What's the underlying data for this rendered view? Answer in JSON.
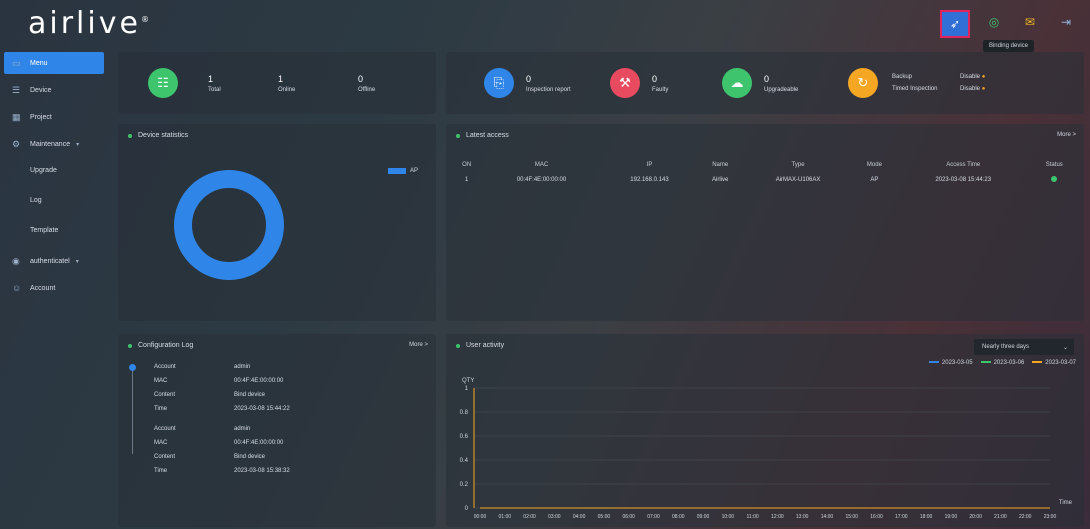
{
  "app": {
    "logo": "airlive",
    "logo_mark": "®"
  },
  "topbar": {
    "icons": [
      "rocket-icon",
      "globe-icon",
      "mail-icon",
      "logout-icon"
    ],
    "tooltip": "Binding device"
  },
  "sidebar": {
    "items": [
      {
        "label": "Menu",
        "icon": "monitor-icon",
        "active": true
      },
      {
        "label": "Device",
        "icon": "list-icon"
      },
      {
        "label": "Project",
        "icon": "project-icon"
      },
      {
        "label": "Maintenance",
        "icon": "maintenance-icon",
        "caret": "▾"
      },
      {
        "label": "Upgrade",
        "sub": true
      },
      {
        "label": "Log",
        "sub": true
      },
      {
        "label": "Template",
        "sub": true
      },
      {
        "label": "authenticatel",
        "icon": "auth-icon",
        "caret": "▾"
      },
      {
        "label": "Account",
        "icon": "user-icon"
      }
    ]
  },
  "stats_left": [
    {
      "value": "1",
      "label": "Total",
      "color": "#3ec46d"
    },
    {
      "value": "1",
      "label": "Online"
    },
    {
      "value": "0",
      "label": "Offline"
    }
  ],
  "stats_right": [
    {
      "value": "0",
      "label": "Inspection report",
      "color": "#2f86e8"
    },
    {
      "value": "0",
      "label": "Faulty",
      "color": "#e84a5f"
    },
    {
      "value": "0",
      "label": "Upgradeable",
      "color": "#3ec46d"
    }
  ],
  "backup": {
    "color": "#f5a623",
    "backup_label": "Backup",
    "backup_value": "Disable",
    "timed_label": "Timed Inspection",
    "timed_value": "Disable"
  },
  "device_stats": {
    "title": "Device statistics",
    "legend": "AP",
    "color": "#2f86e8"
  },
  "latest_access": {
    "title": "Latest access",
    "more": "More >",
    "columns": [
      "ON",
      "MAC",
      "IP",
      "Name",
      "Type",
      "Mode",
      "Access Time",
      "Status"
    ],
    "rows": [
      [
        "1",
        "00:4F:4E:00:00:00",
        "192.168.0.143",
        "Airlive",
        "AirMAX-U106AX",
        "AP",
        "2023-03-08 15:44:23"
      ]
    ]
  },
  "config_log": {
    "title": "Configuration Log",
    "more": "More >",
    "entries": [
      {
        "Account": "admin",
        "MAC": "00:4F:4E:00:00:00",
        "Content": "Bind device",
        "Time": "2023-03-08 15:44:22"
      },
      {
        "Account": "admin",
        "MAC": "00:4F:4E:00:00:00",
        "Content": "Bind device",
        "Time": "2023-03-08 15:38:32"
      }
    ]
  },
  "user_activity": {
    "title": "User activity",
    "select": "Nearly three days",
    "legend": [
      {
        "label": "2023-03-05",
        "color": "#2f86e8"
      },
      {
        "label": "2023-03-06",
        "color": "#3ec46d"
      },
      {
        "label": "2023-03-07",
        "color": "#f5a623"
      }
    ]
  },
  "chart_data": {
    "type": "line",
    "title": "",
    "ylabel": "QTY",
    "xlabel": "Time",
    "ylim": [
      0,
      1
    ],
    "yticks": [
      "1",
      "0.8",
      "0.6",
      "0.4",
      "0.2",
      "0"
    ],
    "x": [
      "00:00",
      "01:00",
      "02:00",
      "03:00",
      "04:00",
      "05:00",
      "06:00",
      "07:00",
      "08:00",
      "09:00",
      "10:00",
      "11:00",
      "12:00",
      "13:00",
      "14:00",
      "15:00",
      "16:00",
      "17:00",
      "18:00",
      "19:00",
      "20:00",
      "21:00",
      "22:00",
      "23:00"
    ],
    "series": [
      {
        "name": "2023-03-05",
        "values": [
          0,
          0,
          0,
          0,
          0,
          0,
          0,
          0,
          0,
          0,
          0,
          0,
          0,
          0,
          0,
          0,
          0,
          0,
          0,
          0,
          0,
          0,
          0,
          0
        ]
      },
      {
        "name": "2023-03-06",
        "values": [
          0,
          0,
          0,
          0,
          0,
          0,
          0,
          0,
          0,
          0,
          0,
          0,
          0,
          0,
          0,
          0,
          0,
          0,
          0,
          0,
          0,
          0,
          0,
          0
        ]
      },
      {
        "name": "2023-03-07",
        "values": [
          0,
          0,
          0,
          0,
          0,
          0,
          0,
          0,
          0,
          0,
          0,
          0,
          0,
          0,
          0,
          0,
          0,
          0,
          0,
          0,
          0,
          0,
          0,
          0
        ]
      }
    ]
  }
}
